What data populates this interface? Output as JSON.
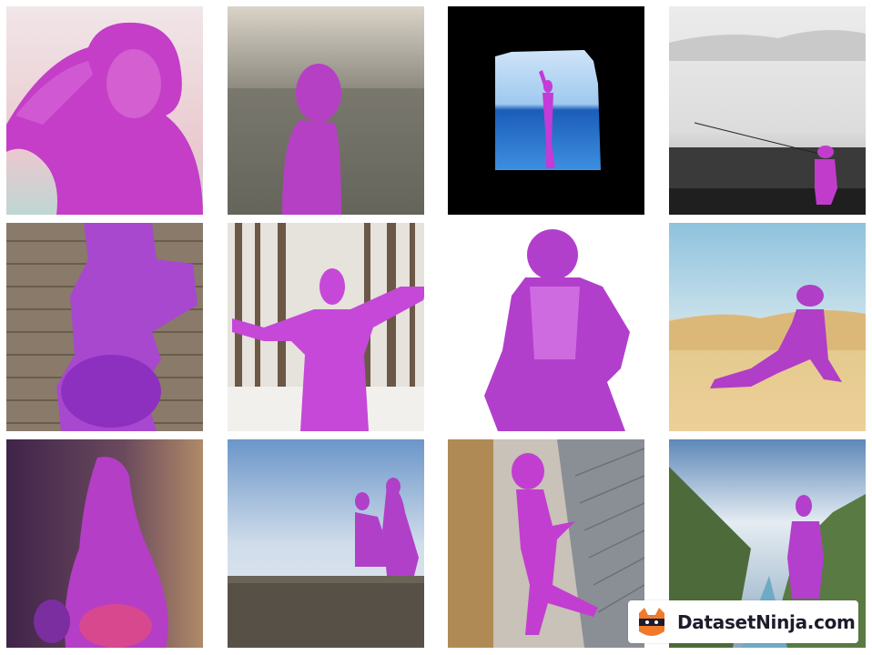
{
  "gallery": {
    "tiles": [
      {
        "scene": "woman-hand-on-forehead"
      },
      {
        "scene": "boy-in-field"
      },
      {
        "scene": "silhouette-in-doorway-ocean"
      },
      {
        "scene": "fisherman-on-pier"
      },
      {
        "scene": "person-lying-on-deck"
      },
      {
        "scene": "child-in-snowy-forest"
      },
      {
        "scene": "woman-posing-white-background"
      },
      {
        "scene": "woman-sitting-on-dunes"
      },
      {
        "scene": "girl-with-flowers"
      },
      {
        "scene": "couple-on-wall-sky"
      },
      {
        "scene": "woman-on-steps"
      },
      {
        "scene": "hiker-mountain-fjord"
      }
    ],
    "mask_color": "#cc33dd"
  },
  "watermark": {
    "brand": "DatasetNinja.com",
    "icon": "ninja-cat-icon"
  }
}
